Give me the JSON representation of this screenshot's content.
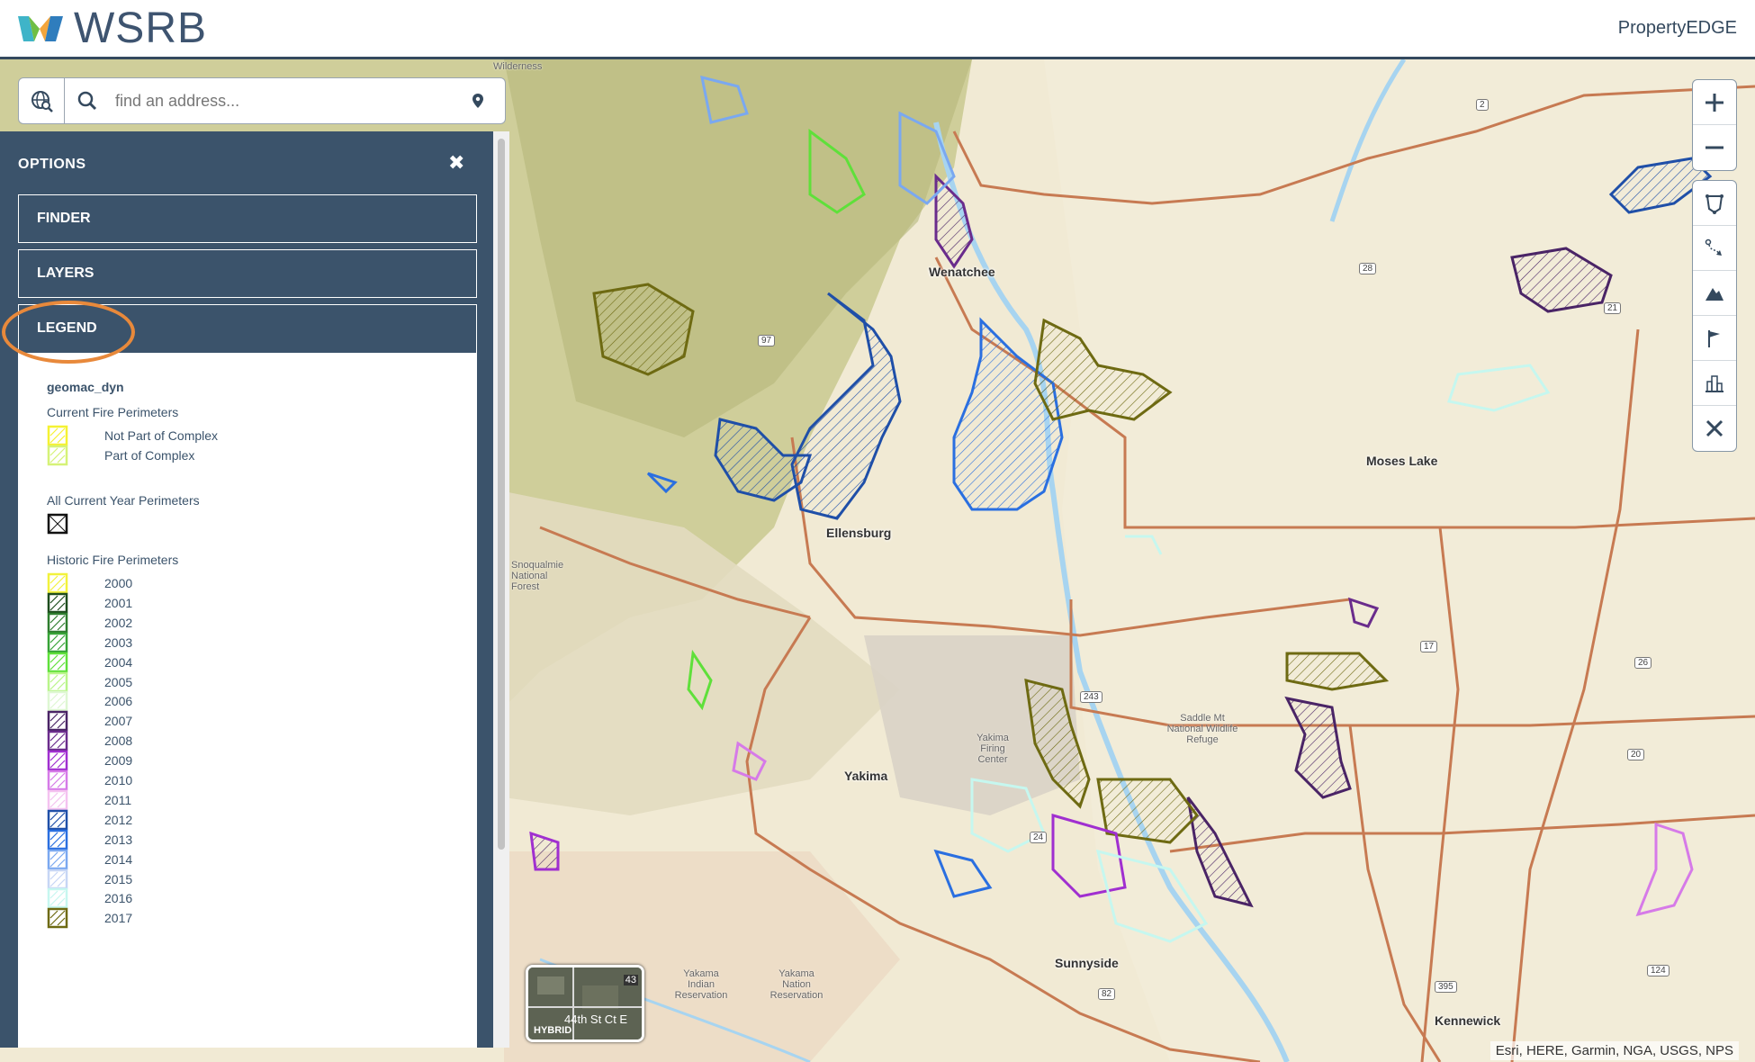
{
  "header": {
    "logo_text": "WSRB",
    "product": "PropertyEDGE"
  },
  "search": {
    "placeholder": "find an address..."
  },
  "panel": {
    "title": "OPTIONS",
    "close_label": "✖",
    "sections": {
      "finder": "FINDER",
      "layers": "LAYERS",
      "legend": "LEGEND"
    }
  },
  "legend": {
    "layer_name": "geomac_dyn",
    "current_heading": "Current Fire Perimeters",
    "current_items": [
      {
        "label": "Not Part of Complex",
        "color": "#f5f232"
      },
      {
        "label": "Part of Complex",
        "color": "#d6f277"
      }
    ],
    "all_current_heading": "All Current Year Perimeters",
    "all_current_color": "#111111",
    "historic_heading": "Historic Fire Perimeters",
    "historic_items": [
      {
        "label": "2000",
        "color": "#f2f23c"
      },
      {
        "label": "2001",
        "color": "#1d4d1d"
      },
      {
        "label": "2002",
        "color": "#2e7d2e"
      },
      {
        "label": "2003",
        "color": "#36a336"
      },
      {
        "label": "2004",
        "color": "#5fe03a"
      },
      {
        "label": "2005",
        "color": "#b9f58a"
      },
      {
        "label": "2006",
        "color": "#def7d2"
      },
      {
        "label": "2007",
        "color": "#4a2466"
      },
      {
        "label": "2008",
        "color": "#6a2c8c"
      },
      {
        "label": "2009",
        "color": "#a02fd0"
      },
      {
        "label": "2010",
        "color": "#d67ae8"
      },
      {
        "label": "2011",
        "color": "#f4c2f0"
      },
      {
        "label": "2012",
        "color": "#1f4fa8"
      },
      {
        "label": "2013",
        "color": "#2a6fe0"
      },
      {
        "label": "2014",
        "color": "#7aa8f0"
      },
      {
        "label": "2015",
        "color": "#c6d6f5"
      },
      {
        "label": "2016",
        "color": "#c6f7ef"
      },
      {
        "label": "2017",
        "color": "#6e6a12"
      }
    ]
  },
  "toolbar": {
    "zoom_in_label": "+",
    "zoom_out_label": "−"
  },
  "map_labels": {
    "wenatchee": "Wenatchee",
    "moses_lake": "Moses Lake",
    "ellensburg": "Ellensburg",
    "yakima": "Yakima",
    "sunnyside": "Sunnyside",
    "kennewick": "Kennewick",
    "yakima_firing_center": "Yakima Firing Center",
    "saddle_mt_refuge": "Saddle Mt National Wildlife Refuge",
    "yakama_indian_res": "Yakama Indian Reservation",
    "yakama_nation_res": "Yakama Nation Reservation",
    "snoqualmie_forest": "Snoqualmie National Forest",
    "wilderness": "Wilderness"
  },
  "highways": [
    "2",
    "28",
    "21",
    "97",
    "17",
    "26",
    "243",
    "24",
    "82",
    "395",
    "124",
    "20",
    "26"
  ],
  "hybrid": {
    "label": "HYBRID",
    "road": "44th St Ct E",
    "route": "43"
  },
  "attribution": "Esri, HERE, Garmin, NGA, USGS, NPS",
  "colors": {
    "panel": "#3b536b",
    "accent_ring": "#e8893b",
    "header_border": "#34495e"
  }
}
